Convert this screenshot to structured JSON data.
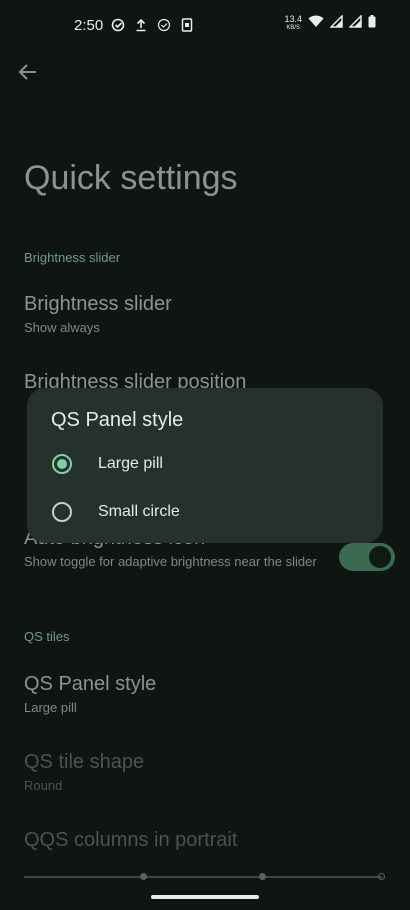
{
  "status_bar": {
    "time": "2:50",
    "net_speed": "13.4",
    "net_unit": "KB/S",
    "icons": [
      "check-circle-icon",
      "upload-icon",
      "check-circle-outline-icon",
      "sim-icon",
      "wifi-icon",
      "signal-icon",
      "signal-icon",
      "battery-icon"
    ]
  },
  "page": {
    "title": "Quick settings",
    "sections": [
      {
        "header": "Brightness slider"
      },
      {
        "header": "QS tiles"
      }
    ],
    "items": [
      {
        "title": "Brightness slider",
        "subtitle": "Show always"
      },
      {
        "title": "Brightness slider position",
        "subtitle": ""
      },
      {
        "title": "Auto brightness icon",
        "subtitle": "Show toggle for adaptive brightness near the slider"
      },
      {
        "title": "QS Panel style",
        "subtitle": "Large pill"
      },
      {
        "title": "QS tile shape",
        "subtitle": "Round"
      },
      {
        "title": "QQS columns in portrait",
        "subtitle": ""
      }
    ],
    "auto_brightness_toggle": "on"
  },
  "dialog": {
    "title": "QS Panel style",
    "options": [
      {
        "label": "Large pill",
        "selected": true
      },
      {
        "label": "Small circle",
        "selected": false
      }
    ]
  },
  "colors": {
    "background": "#0f1513",
    "dialog": "#26302c",
    "accent": "#7fd1a6",
    "section_header": "#6e9c86"
  }
}
